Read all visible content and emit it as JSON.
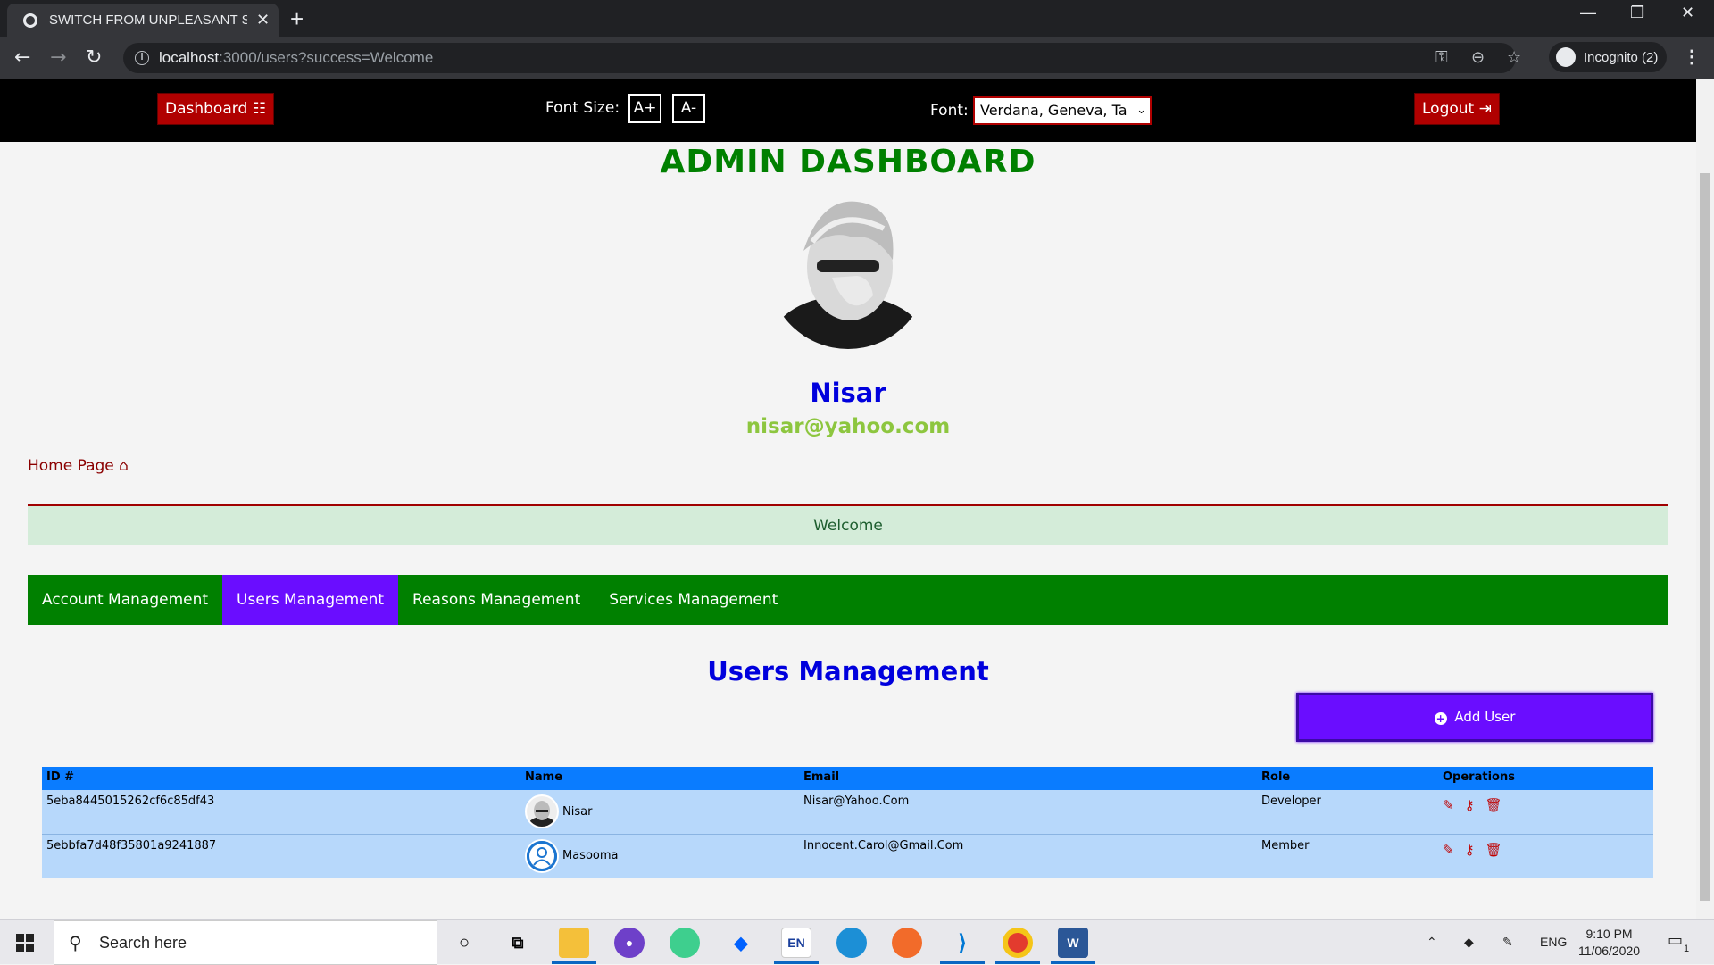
{
  "browser": {
    "tab_title": "SWITCH FROM UNPLEASANT SC",
    "url_host": "localhost",
    "url_rest": ":3000/users?success=Welcome",
    "incognito_label": "Incognito (2)"
  },
  "topnav": {
    "dashboard_label": "Dashboard",
    "font_size_label": "Font Size:",
    "font_increase": "A+",
    "font_decrease": "A-",
    "font_label": "Font:",
    "font_selected": "Verdana, Geneva, Ta",
    "logout_label": "Logout"
  },
  "header": {
    "title": "ADMIN DASHBOARD",
    "user_name": "Nisar",
    "user_email": "nisar@yahoo.com"
  },
  "home_link": "Home Page",
  "alert": {
    "message": "Welcome"
  },
  "menu": {
    "tabs": [
      {
        "label": "Account Management"
      },
      {
        "label": "Users Management"
      },
      {
        "label": "Reasons Management"
      },
      {
        "label": "Services Management"
      }
    ],
    "active": "Users Management"
  },
  "users_section": {
    "title": "Users Management",
    "add_button": "Add User",
    "columns": [
      "ID #",
      "Name",
      "Email",
      "Role",
      "Operations"
    ],
    "rows": [
      {
        "id": "5eba8445015262cf6c85df43",
        "name": "Nisar",
        "email": "Nisar@Yahoo.Com",
        "role": "Developer"
      },
      {
        "id": "5ebbfa7d48f35801a9241887",
        "name": "Masooma",
        "email": "Innocent.Carol@Gmail.Com",
        "role": "Member"
      }
    ]
  },
  "taskbar": {
    "search_placeholder": "Search here",
    "lang": "ENG",
    "time": "9:10 PM",
    "date": "11/06/2020",
    "notification_count": "1"
  },
  "colors": {
    "brand_green": "#008000",
    "accent_purple": "#6a0dff",
    "danger_red": "#b00000",
    "table_header": "#0a7cff",
    "table_row": "#b7d8fb"
  }
}
